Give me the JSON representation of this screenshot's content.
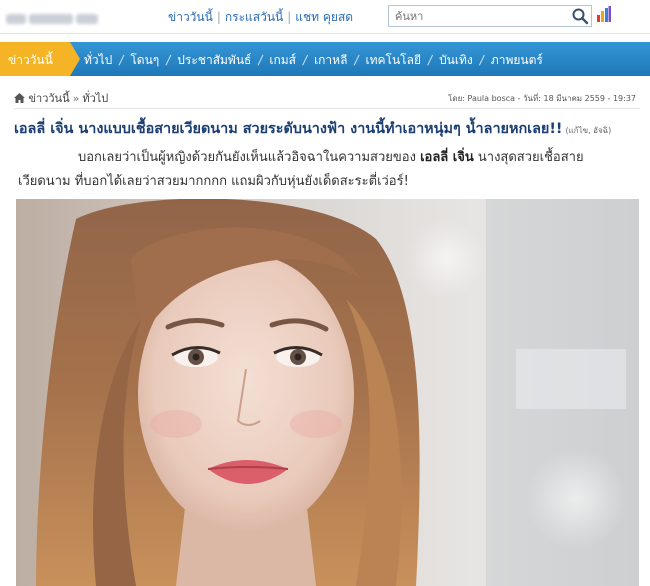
{
  "topbar": {
    "links": [
      "ข่าววันนี้",
      "กระแสวันนี้",
      "แชท คุยสด"
    ],
    "search_placeholder": "ค้นหา"
  },
  "nav": {
    "home": "ข่าววันนี้",
    "items": [
      "ทั่วไป",
      "โดนๆ",
      "ประชาสัมพันธ์",
      "เกมส์",
      "เกาหลี",
      "เทคโนโลยี",
      "บันเทิง",
      "ภาพยนตร์"
    ]
  },
  "breadcrumb": {
    "home": "ข่าววันนี้",
    "section": "ทั่วไป",
    "byline": "โดย: Paula bosca - วันที่: 18 มีนาคม 2559 - 19:37"
  },
  "article": {
    "headline": "เอลลี่ เจิ่น นางแบบเชื้อสายเวียดนาม สวยระดับนางฟ้า งานนี้ทำเอาหนุ่มๆ น้ำลายหกเลย!!",
    "credit": "(แก้ไข, อัจฉิ)",
    "intro_1": "บอกเลยว่าเป็นผู้หญิงด้วยกันยังเห็นแล้วอิจฉาในความสวยของ",
    "intro_name": "เอลลี่ เจิ่น",
    "intro_2": " นางสุดสวยเชื้อสาย",
    "intro_3": "เวียดนาม ที่บอกได้เลยว่าสวยมากกกก แถมผิวกับหุ่นยังเด็ดสะระตี่เว่อร์!"
  },
  "icons": {
    "home": "home-icon",
    "search": "search-icon",
    "stats": "bar-chart-icon"
  },
  "colors": {
    "nav_blue": "#2a88c9",
    "nav_home": "#f4b426",
    "headline": "#1c3f73",
    "link": "#2a6bb5"
  }
}
